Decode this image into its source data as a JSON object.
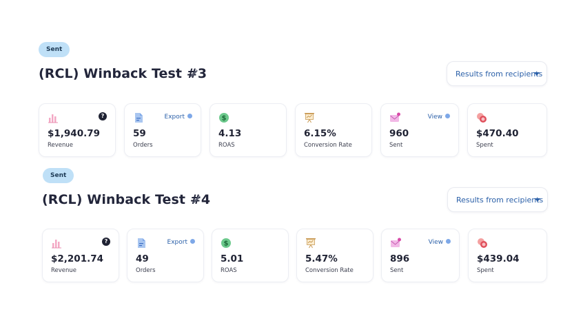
{
  "campaigns": [
    {
      "status": "Sent",
      "title": "(RCL) Winback Test #3",
      "results_filter": "Results from recipients",
      "metrics": {
        "revenue": {
          "value": "$1,940.79",
          "label": "Revenue"
        },
        "orders": {
          "value": "59",
          "label": "Orders",
          "action": "Export"
        },
        "roas": {
          "value": "4.13",
          "label": "ROAS"
        },
        "conversion": {
          "value": "6.15%",
          "label": "Conversion Rate"
        },
        "sent": {
          "value": "960",
          "label": "Sent",
          "action": "View"
        },
        "spent": {
          "value": "$470.40",
          "label": "Spent"
        }
      }
    },
    {
      "status": "Sent",
      "title": "(RCL) Winback Test #4",
      "results_filter": "Results from recipients",
      "metrics": {
        "revenue": {
          "value": "$2,201.74",
          "label": "Revenue"
        },
        "orders": {
          "value": "49",
          "label": "Orders",
          "action": "Export"
        },
        "roas": {
          "value": "5.01",
          "label": "ROAS"
        },
        "conversion": {
          "value": "5.47%",
          "label": "Conversion Rate"
        },
        "sent": {
          "value": "896",
          "label": "Sent",
          "action": "View"
        },
        "spent": {
          "value": "$439.04",
          "label": "Spent"
        }
      }
    }
  ],
  "help_glyph": "?",
  "icons": {
    "revenue": "bar-chart-icon",
    "orders": "document-icon",
    "roas": "dollar-coin-icon",
    "conversion": "presentation-icon",
    "sent": "mail-icon",
    "spent": "coins-icon"
  },
  "colors": {
    "badge_bg": "#bfe0f7",
    "link_blue": "#2a5fa8",
    "title": "#22253a"
  }
}
